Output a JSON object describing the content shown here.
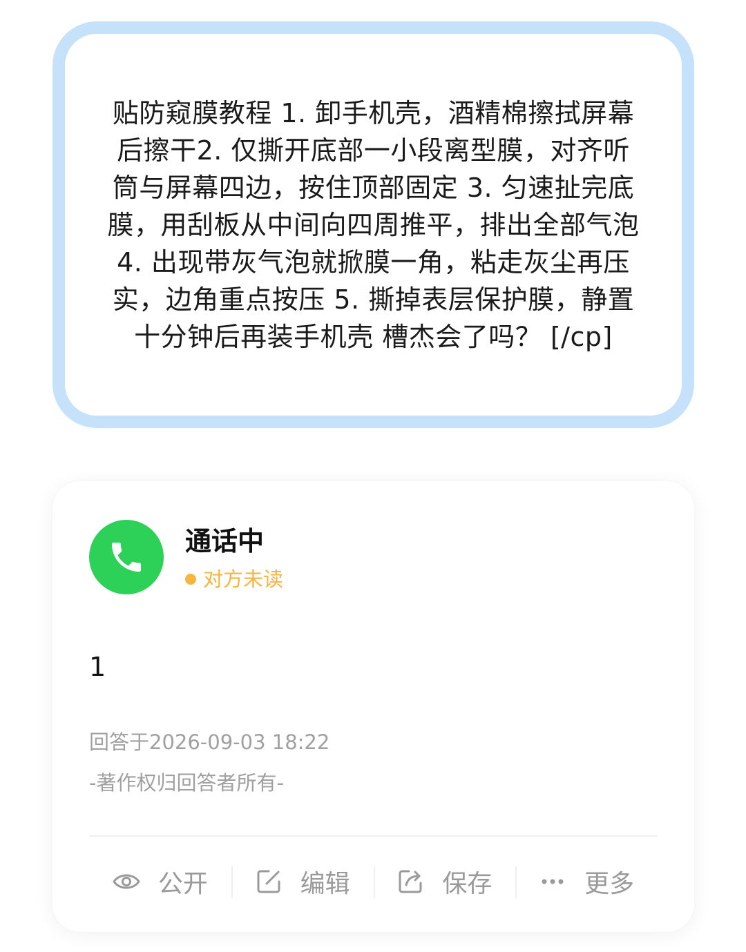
{
  "question": {
    "text": "贴防窥膜教程 1. 卸手机壳，酒精棉擦拭屏幕后擦干2. 仅撕开底部一小段离型膜，对齐听筒与屏幕四边，按住顶部固定 3. 匀速扯完底膜，用刮板从中间向四周推平，排出全部气泡 4. 出现带灰气泡就掀膜一角，粘走灰尘再压实，边角重点按压 5. 撕掉表层保护膜，静置十分钟后再装手机壳  槽杰会了吗？ [/cp]"
  },
  "answer": {
    "icon": "phone-icon",
    "title": "通话中",
    "status": "对方未读",
    "status_color": "#f5b53f",
    "body": "1",
    "time": "回答于2026-09-03 18:22",
    "copyright": "-著作权归回答者所有-"
  },
  "actions": [
    {
      "icon": "eye-icon",
      "label": "公开"
    },
    {
      "icon": "edit-icon",
      "label": "编辑"
    },
    {
      "icon": "share-icon",
      "label": "保存"
    },
    {
      "icon": "more-icon",
      "label": "更多"
    }
  ],
  "colors": {
    "bubble_border": "#c6e2fb",
    "call_green": "#2ed158",
    "muted_text": "#a0a0a0"
  }
}
